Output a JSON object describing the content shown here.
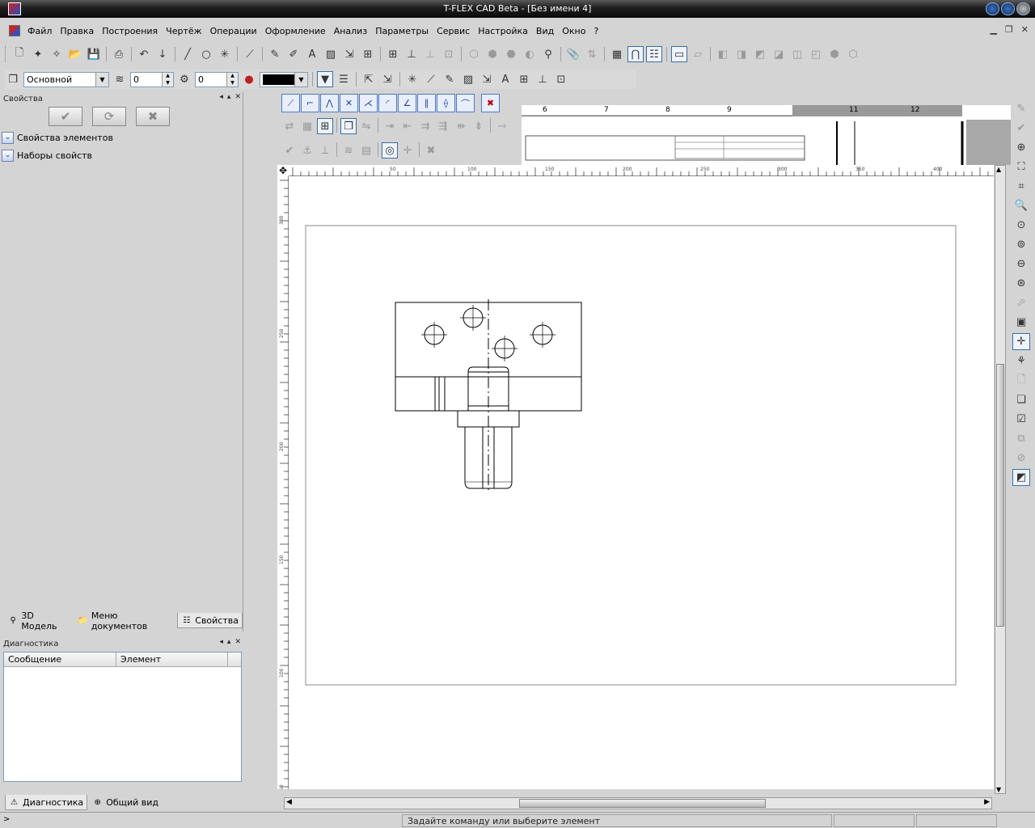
{
  "window": {
    "title": "T-FLEX CAD Beta - [Без имени 4]"
  },
  "menu": [
    "Файл",
    "Правка",
    "Построения",
    "Чертёж",
    "Операции",
    "Оформление",
    "Анализ",
    "Параметры",
    "Сервис",
    "Настройка",
    "Вид",
    "Окно",
    "?"
  ],
  "toolbar2": {
    "layer": "Основной",
    "level": "0",
    "priority": "0",
    "color": "#000000"
  },
  "props_panel": {
    "title": "Свойства",
    "sections": [
      "Свойства элементов",
      "Наборы свойств"
    ],
    "tabs": [
      {
        "label": "3D Модель",
        "icon": "3d-model-icon"
      },
      {
        "label": "Меню документов",
        "icon": "folder-icon"
      },
      {
        "label": "Свойства",
        "icon": "properties-icon"
      }
    ]
  },
  "diagnostics": {
    "title": "Диагностика",
    "columns": [
      "Сообщение",
      "Элемент"
    ],
    "tabs": [
      {
        "label": "Диагностика",
        "icon": "warning-icon"
      },
      {
        "label": "Общий вид",
        "icon": "zoom-icon"
      }
    ]
  },
  "preview_ruler": {
    "ticks": [
      "6",
      "7",
      "8",
      "9",
      "11",
      "12"
    ]
  },
  "hruler_ticks": [
    "50",
    "100",
    "150",
    "200",
    "250",
    "300",
    "350",
    "400"
  ],
  "vruler_ticks": [
    "300",
    "250",
    "200",
    "150",
    "100",
    "50"
  ],
  "status": {
    "left": ">",
    "message": "Задайте команду или выберите элемент"
  }
}
